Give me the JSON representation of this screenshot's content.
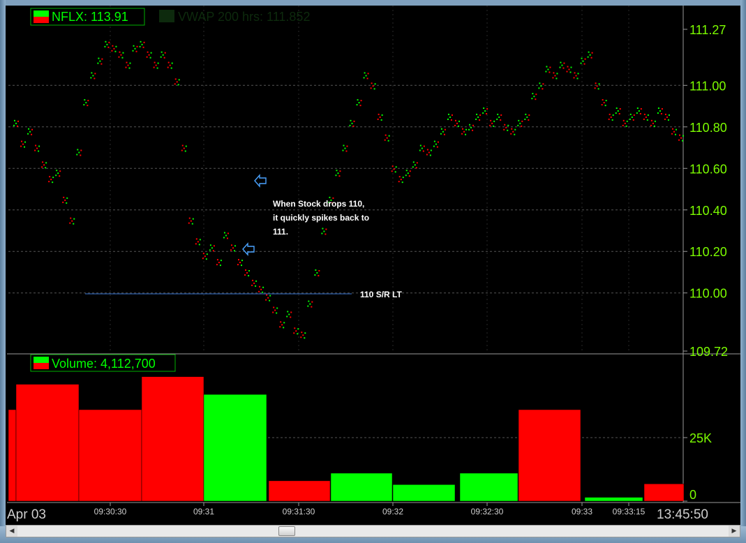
{
  "price_panel": {
    "symbol_label": "NFLX: 113.91",
    "vwap_label": "VWAP 200 hrs: 111.852",
    "y_ticks": [
      "111.27",
      "111.00",
      "110.80",
      "110.60",
      "110.40",
      "110.20",
      "110.00",
      "109.72"
    ]
  },
  "volume_panel": {
    "label": "Volume: 4,112,700",
    "y_ticks": [
      "25K",
      "0"
    ]
  },
  "x_axis": {
    "date_label": "Apr 03",
    "time_ticks": [
      "09:30:30",
      "09:31",
      "09:31:30",
      "09:32",
      "09:32:30",
      "09:33",
      "09:33:15"
    ],
    "clock": "13:45:50"
  },
  "annotations": {
    "note_line1": "When Stock drops 110,",
    "note_line2": "it quickly spikes back to",
    "note_line3": "111.",
    "support_label": "110 S/R LT"
  },
  "colors": {
    "up": "#00ff00",
    "down": "#ff0000",
    "axis_text": "#7cfc00",
    "grid": "#555555",
    "support_line": "#3a78d8",
    "arrow": "#4aa3ff"
  },
  "chart_data": [
    {
      "type": "scatter",
      "title": "NFLX: 113.91",
      "ylim": [
        109.72,
        111.27
      ],
      "y_ticks": [
        111.27,
        111.0,
        110.8,
        110.6,
        110.4,
        110.2,
        110.0,
        109.72
      ],
      "grid": true,
      "series": [
        {
          "name": "NFLX",
          "points": [
            [
              0.0,
              110.82
            ],
            [
              0.5,
              110.72
            ],
            [
              1.0,
              110.78
            ],
            [
              1.5,
              110.7
            ],
            [
              2.0,
              110.62
            ],
            [
              2.5,
              110.55
            ],
            [
              3.0,
              110.58
            ],
            [
              3.5,
              110.45
            ],
            [
              4.0,
              110.35
            ],
            [
              4.5,
              110.68
            ],
            [
              5.0,
              110.92
            ],
            [
              5.5,
              111.05
            ],
            [
              6.0,
              111.12
            ],
            [
              6.5,
              111.2
            ],
            [
              7.0,
              111.18
            ],
            [
              7.5,
              111.15
            ],
            [
              8.0,
              111.1
            ],
            [
              8.5,
              111.18
            ],
            [
              9.0,
              111.2
            ],
            [
              9.5,
              111.15
            ],
            [
              10.0,
              111.1
            ],
            [
              10.5,
              111.15
            ],
            [
              11.0,
              111.1
            ],
            [
              11.5,
              111.02
            ],
            [
              12.0,
              110.7
            ],
            [
              12.5,
              110.35
            ],
            [
              13.0,
              110.25
            ],
            [
              13.5,
              110.18
            ],
            [
              14.0,
              110.22
            ],
            [
              14.5,
              110.15
            ],
            [
              15.0,
              110.28
            ],
            [
              15.5,
              110.22
            ],
            [
              16.0,
              110.15
            ],
            [
              16.5,
              110.1
            ],
            [
              17.0,
              110.05
            ],
            [
              17.5,
              110.02
            ],
            [
              18.0,
              109.98
            ],
            [
              18.5,
              109.92
            ],
            [
              19.0,
              109.85
            ],
            [
              19.5,
              109.9
            ],
            [
              20.0,
              109.82
            ],
            [
              20.5,
              109.8
            ],
            [
              21.0,
              109.95
            ],
            [
              21.5,
              110.1
            ],
            [
              22.0,
              110.3
            ],
            [
              22.5,
              110.45
            ],
            [
              23.0,
              110.58
            ],
            [
              23.5,
              110.7
            ],
            [
              24.0,
              110.82
            ],
            [
              24.5,
              110.92
            ],
            [
              25.0,
              111.05
            ],
            [
              25.5,
              111.0
            ],
            [
              26.0,
              110.85
            ],
            [
              26.5,
              110.75
            ],
            [
              27.0,
              110.6
            ],
            [
              27.5,
              110.55
            ],
            [
              28.0,
              110.58
            ],
            [
              28.5,
              110.62
            ],
            [
              29.0,
              110.7
            ],
            [
              29.5,
              110.68
            ],
            [
              30.0,
              110.72
            ],
            [
              30.5,
              110.78
            ],
            [
              31.0,
              110.85
            ],
            [
              31.5,
              110.82
            ],
            [
              32.0,
              110.78
            ],
            [
              32.5,
              110.8
            ],
            [
              33.0,
              110.85
            ],
            [
              33.5,
              110.88
            ],
            [
              34.0,
              110.82
            ],
            [
              34.5,
              110.85
            ],
            [
              35.0,
              110.8
            ],
            [
              35.5,
              110.78
            ],
            [
              36.0,
              110.82
            ],
            [
              36.5,
              110.85
            ],
            [
              37.0,
              110.95
            ],
            [
              37.5,
              111.0
            ],
            [
              38.0,
              111.08
            ],
            [
              38.5,
              111.05
            ],
            [
              39.0,
              111.1
            ],
            [
              39.5,
              111.08
            ],
            [
              40.0,
              111.05
            ],
            [
              40.5,
              111.12
            ],
            [
              41.0,
              111.15
            ],
            [
              41.5,
              111.0
            ],
            [
              42.0,
              110.92
            ],
            [
              42.5,
              110.85
            ],
            [
              43.0,
              110.88
            ],
            [
              43.5,
              110.82
            ],
            [
              44.0,
              110.85
            ],
            [
              44.5,
              110.88
            ],
            [
              45.0,
              110.85
            ],
            [
              45.5,
              110.82
            ],
            [
              46.0,
              110.88
            ],
            [
              46.5,
              110.85
            ],
            [
              47.0,
              110.78
            ],
            [
              47.5,
              110.75
            ]
          ]
        }
      ]
    },
    {
      "type": "bar",
      "title": "Volume: 4,112,700",
      "categories": [
        "bar1",
        "bar2",
        "bar3",
        "bar4",
        "bar5",
        "bar6",
        "bar7",
        "bar8",
        "bar9",
        "bar10",
        "bar11",
        "bar12"
      ],
      "values": [
        36000,
        46000,
        36000,
        49000,
        42000,
        8000,
        11000,
        6500,
        11000,
        36000,
        1500,
        6800
      ],
      "bar_colors": [
        "down",
        "down",
        "down",
        "down",
        "up",
        "down",
        "up",
        "up",
        "up",
        "down",
        "up",
        "down"
      ],
      "ylim": [
        0,
        50000
      ],
      "y_ticks": [
        25000,
        0
      ],
      "grid": true
    }
  ]
}
